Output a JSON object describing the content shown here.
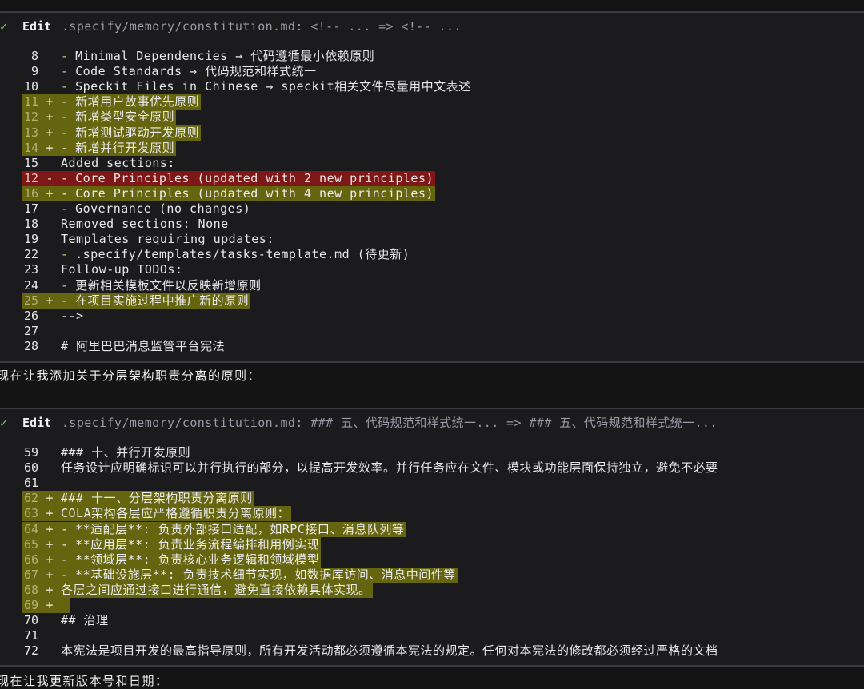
{
  "edit1": {
    "check": "✓",
    "label": "Edit",
    "path": ".specify/memory/constitution.md: <!-- ... => <!-- ...",
    "lines": [
      {
        "n": "8",
        "m": "",
        "type": "ctx",
        "dash": "-",
        "text": "Minimal Dependencies → 代码遵循最小依赖原则"
      },
      {
        "n": "9",
        "m": "",
        "type": "ctx",
        "dash": "-",
        "text": "Code Standards → 代码规范和样式统一"
      },
      {
        "n": "10",
        "m": "",
        "type": "ctx",
        "dash": "-",
        "text": "Speckit Files in Chinese → speckit相关文件尽量用中文表述"
      },
      {
        "n": "11",
        "m": "+",
        "type": "add",
        "dash": "-",
        "text": "新增用户故事优先原则"
      },
      {
        "n": "12",
        "m": "+",
        "type": "add",
        "dash": "-",
        "text": "新增类型安全原则"
      },
      {
        "n": "13",
        "m": "+",
        "type": "add",
        "dash": "-",
        "text": "新增测试驱动开发原则"
      },
      {
        "n": "14",
        "m": "+",
        "type": "add",
        "dash": "-",
        "text": "新增并行开发原则"
      },
      {
        "n": "15",
        "m": "",
        "type": "ctx",
        "dash": "",
        "text": "Added sections:"
      },
      {
        "n": "12",
        "m": "-",
        "type": "del",
        "dash": "-",
        "text": "Core Principles (updated with 2 new principles)"
      },
      {
        "n": "16",
        "m": "+",
        "type": "add",
        "dash": "-",
        "text": "Core Principles (updated with 4 new principles)"
      },
      {
        "n": "17",
        "m": "",
        "type": "ctx",
        "dash": "-",
        "text": "Governance (no changes)"
      },
      {
        "n": "18",
        "m": "",
        "type": "ctx",
        "dash": "",
        "text": "Removed sections: None"
      },
      {
        "n": "19",
        "m": "",
        "type": "ctx",
        "dash": "",
        "text": "Templates requiring updates:"
      },
      {
        "n": "22",
        "m": "",
        "type": "ctx",
        "dash": "-",
        "text": ".specify/templates/tasks-template.md (待更新)"
      },
      {
        "n": "23",
        "m": "",
        "type": "ctx",
        "dash": "",
        "text": "Follow-up TODOs:"
      },
      {
        "n": "24",
        "m": "",
        "type": "ctx",
        "dash": "-",
        "text": "更新相关模板文件以反映新增原则"
      },
      {
        "n": "25",
        "m": "+",
        "type": "add",
        "dash": "-",
        "text": "在项目实施过程中推广新的原则"
      },
      {
        "n": "26",
        "m": "",
        "type": "ctx",
        "dash": "",
        "text": "-->"
      },
      {
        "n": "27",
        "m": "",
        "type": "ctx",
        "dash": "",
        "text": ""
      },
      {
        "n": "28",
        "m": "",
        "type": "ctx",
        "dash": "",
        "text": "# 阿里巴巴消息监管平台宪法"
      }
    ]
  },
  "message1": "现在让我添加关于分层架构职责分离的原则：",
  "edit2": {
    "check": "✓",
    "label": "Edit",
    "path": ".specify/memory/constitution.md: ### 五、代码规范和样式统一... => ### 五、代码规范和样式统一...",
    "lines": [
      {
        "n": "59",
        "m": "",
        "type": "ctx",
        "dash": "",
        "text": "### 十、并行开发原则"
      },
      {
        "n": "60",
        "m": "",
        "type": "ctx",
        "dash": "",
        "text": "任务设计应明确标识可以并行执行的部分，以提高开发效率。并行任务应在文件、模块或功能层面保持独立，避免不必要"
      },
      {
        "n": "61",
        "m": "",
        "type": "ctx",
        "dash": "",
        "text": ""
      },
      {
        "n": "62",
        "m": "+",
        "type": "add",
        "dash": "",
        "text": "### 十一、分层架构职责分离原则"
      },
      {
        "n": "63",
        "m": "+",
        "type": "add",
        "dash": "",
        "text": "COLA架构各层应严格遵循职责分离原则："
      },
      {
        "n": "64",
        "m": "+",
        "type": "add",
        "dash": "-",
        "text": "**适配层**: 负责外部接口适配，如RPC接口、消息队列等"
      },
      {
        "n": "65",
        "m": "+",
        "type": "add",
        "dash": "-",
        "text": "**应用层**: 负责业务流程编排和用例实现"
      },
      {
        "n": "66",
        "m": "+",
        "type": "add",
        "dash": "-",
        "text": "**领域层**: 负责核心业务逻辑和领域模型"
      },
      {
        "n": "67",
        "m": "+",
        "type": "add",
        "dash": "-",
        "text": "**基础设施层**: 负责技术细节实现，如数据库访问、消息中间件等"
      },
      {
        "n": "68",
        "m": "+",
        "type": "add",
        "dash": "",
        "text": "各层之间应通过接口进行通信，避免直接依赖具体实现。"
      },
      {
        "n": "69",
        "m": "+",
        "type": "add",
        "dash": "",
        "text": ""
      },
      {
        "n": "70",
        "m": "",
        "type": "ctx",
        "dash": "",
        "text": "## 治理"
      },
      {
        "n": "71",
        "m": "",
        "type": "ctx",
        "dash": "",
        "text": ""
      },
      {
        "n": "72",
        "m": "",
        "type": "ctx",
        "dash": "",
        "text": "本宪法是项目开发的最高指导原则，所有开发活动都必须遵循本宪法的规定。任何对本宪法的修改都必须经过严格的文档"
      }
    ]
  },
  "message2": "现在让我更新版本号和日期："
}
